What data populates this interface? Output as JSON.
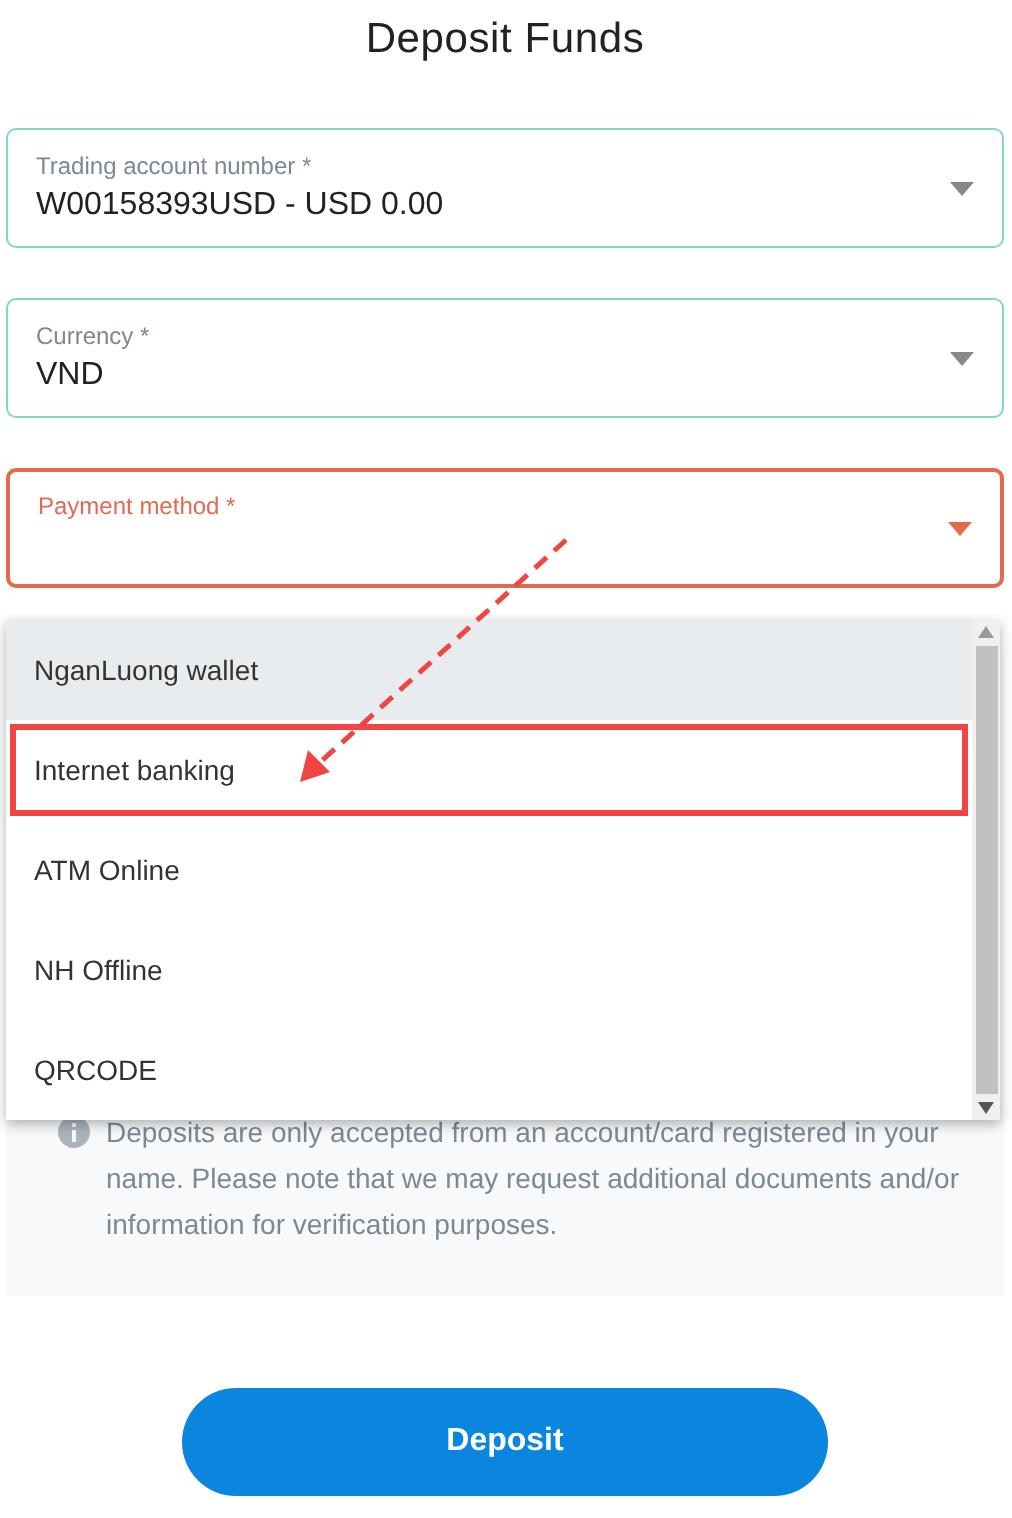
{
  "title": "Deposit Funds",
  "fields": [
    {
      "label": "Trading account number *",
      "value": "W00158393USD - USD 0.00",
      "error": false
    },
    {
      "label": "Currency *",
      "value": "VND",
      "error": false
    },
    {
      "label": "Payment method *",
      "error": true
    }
  ],
  "menu": {
    "items": [
      {
        "label": "NganLuong wallet",
        "hovered": true,
        "highlighted": false
      },
      {
        "label": "Internet banking",
        "hovered": false,
        "highlighted": true
      },
      {
        "label": "ATM Online",
        "hovered": false,
        "highlighted": false
      },
      {
        "label": "NH Offline",
        "hovered": false,
        "highlighted": false
      },
      {
        "label": "QRCODE",
        "hovered": false,
        "highlighted": false
      }
    ]
  },
  "notice": "Deposits are only accepted from an account/card registered in your name. Please note that we may request additional documents and/or information for verification purposes.",
  "button": "Deposit"
}
